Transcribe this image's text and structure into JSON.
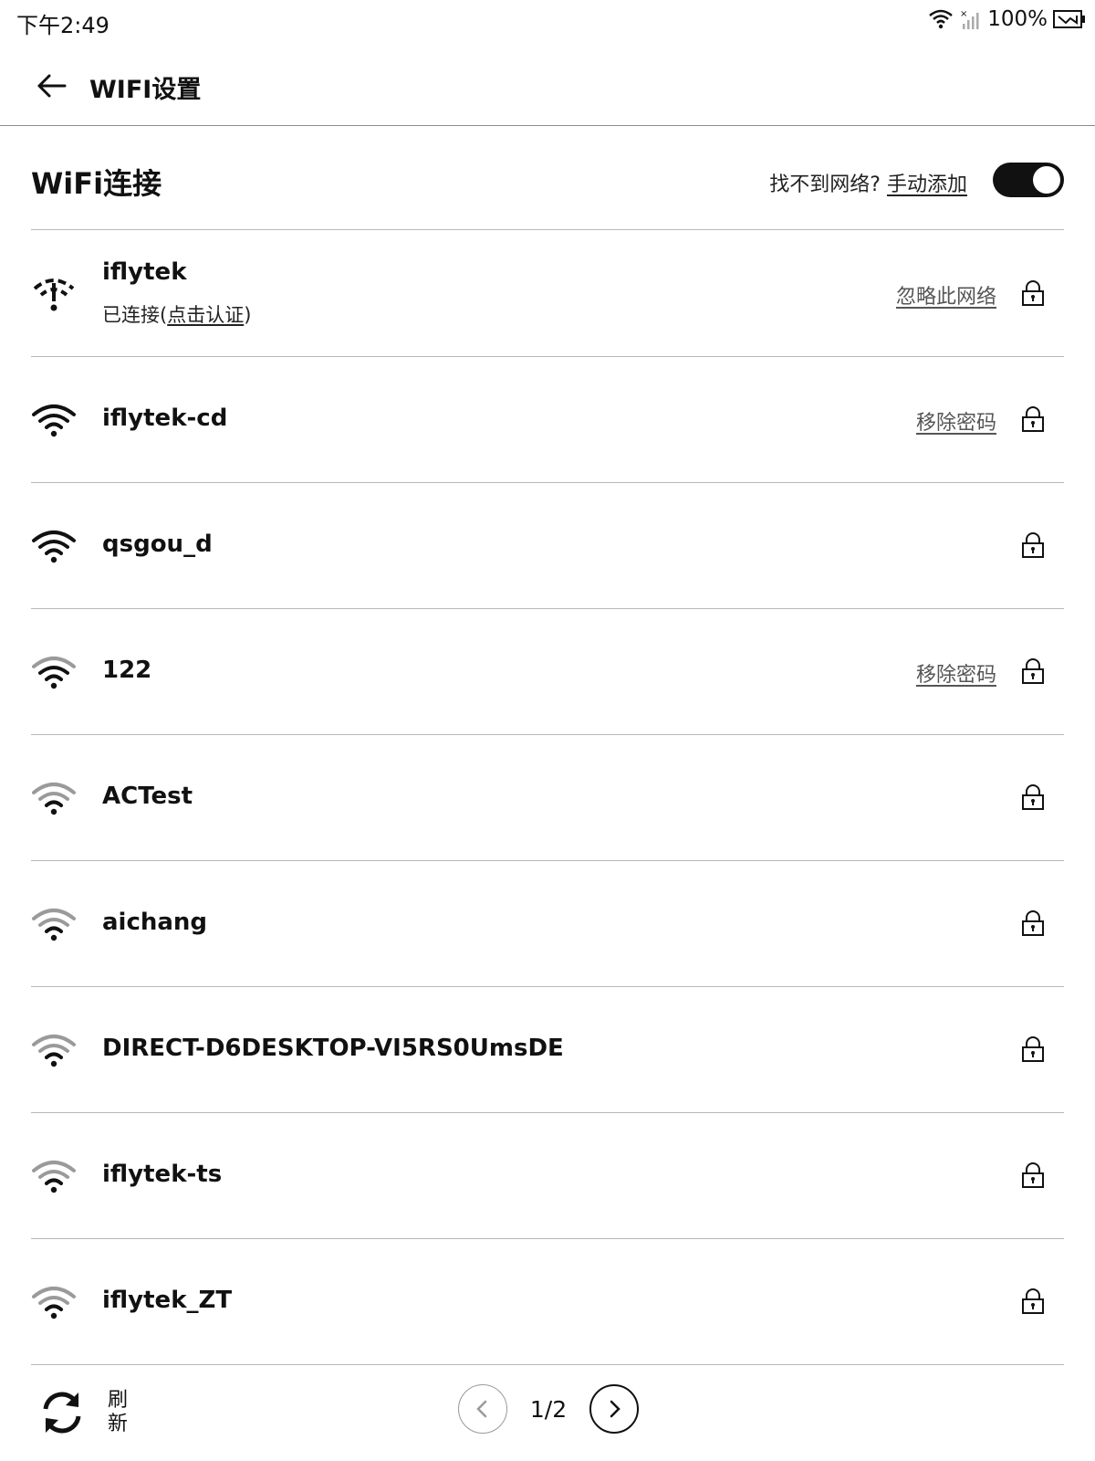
{
  "status_bar": {
    "time": "下午2:49",
    "battery": "100%",
    "icons": [
      "wifi-icon",
      "no-signal-icon",
      "battery-charging-icon"
    ]
  },
  "header": {
    "back_icon": "arrow-left-icon",
    "title": "WIFI设置"
  },
  "section": {
    "title": "WiFi连接",
    "manual_prompt": "找不到网络?",
    "manual_add": "手动添加",
    "wifi_enabled": true
  },
  "networks": [
    {
      "name": "iflytek",
      "status_prefix": "已连接(",
      "status_link": "点击认证",
      "status_suffix": ")",
      "action": "忽略此网络",
      "signal": "connected",
      "locked": true
    },
    {
      "name": "iflytek-cd",
      "action": "移除密码",
      "signal": "strong",
      "locked": true
    },
    {
      "name": "qsgou_d",
      "action": "",
      "signal": "strong",
      "locked": true
    },
    {
      "name": "122",
      "action": "移除密码",
      "signal": "medium",
      "locked": true
    },
    {
      "name": "ACTest",
      "action": "",
      "signal": "weak",
      "locked": true
    },
    {
      "name": "aichang",
      "action": "",
      "signal": "weak",
      "locked": true
    },
    {
      "name": "DIRECT-D6DESKTOP-VI5RS0UmsDE",
      "action": "",
      "signal": "weak",
      "locked": true
    },
    {
      "name": "iflytek-ts",
      "action": "",
      "signal": "weak",
      "locked": true
    },
    {
      "name": "iflytek_ZT",
      "action": "",
      "signal": "weak",
      "locked": true
    }
  ],
  "bottom": {
    "refresh_label": "刷新",
    "page_indicator": "1/2"
  },
  "colors": {
    "text": "#111111",
    "divider": "#b8b8b8",
    "link_gray": "#555555",
    "weak_signal": "#9a9a9a"
  }
}
